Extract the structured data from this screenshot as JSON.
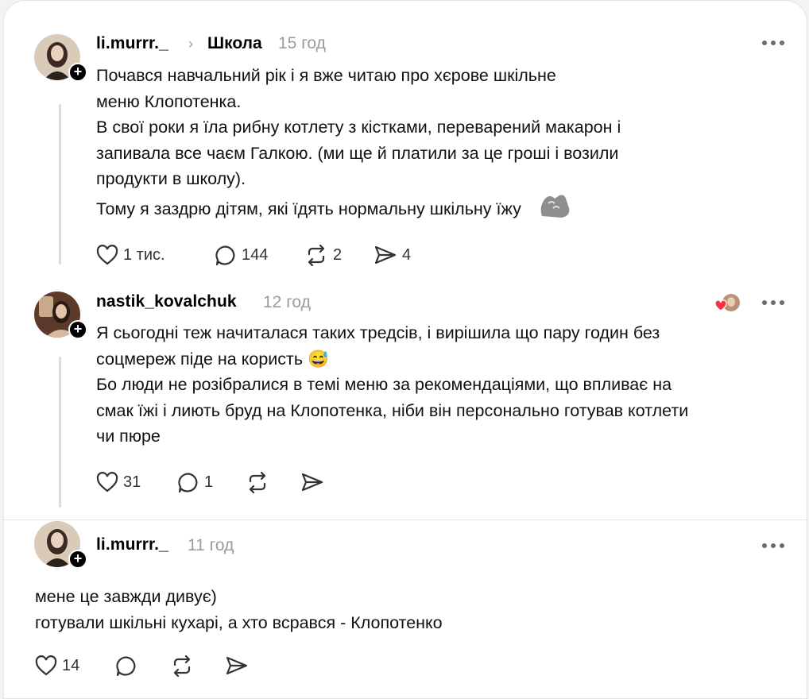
{
  "posts": [
    {
      "username": "li.murrr._",
      "topic": "Школа",
      "time": "15 год",
      "lines": [
        "Почався навчальний рік і я вже читаю про хєрове шкільне",
        "меню Клопотенка.",
        "В свої роки я їла рибну котлету з кістками, переварений макарон і",
        "запивала все чаєм Галкою. (ми ще й платили за це гроші і возили",
        "продукти в школу).",
        "Тому я заздрю дітям, які їдять нормальну шкільну їжу"
      ],
      "likes": "1 тис.",
      "replies": "144",
      "reposts": "2",
      "shares": "4"
    },
    {
      "username": "nastik_kovalchuk",
      "time": "12 год",
      "lines": [
        "Я сьогодні теж начиталася таких тредсів, і вирішила що пару годин без",
        "соцмереж піде на користь 😅",
        "Бо люди не розібралися в темі меню за рекомендаціями, що впливає на",
        "смак їжі і лиють бруд на Клопотенка, ніби він персонально готував котлети",
        "чи пюре"
      ],
      "likes": "31",
      "replies": "1"
    },
    {
      "username": "li.murrr._",
      "time": "11 год",
      "lines": [
        "мене це завжди дивує)",
        "готували шкільні кухарі, а хто всрався - Клопотенко"
      ],
      "likes": "14"
    }
  ]
}
